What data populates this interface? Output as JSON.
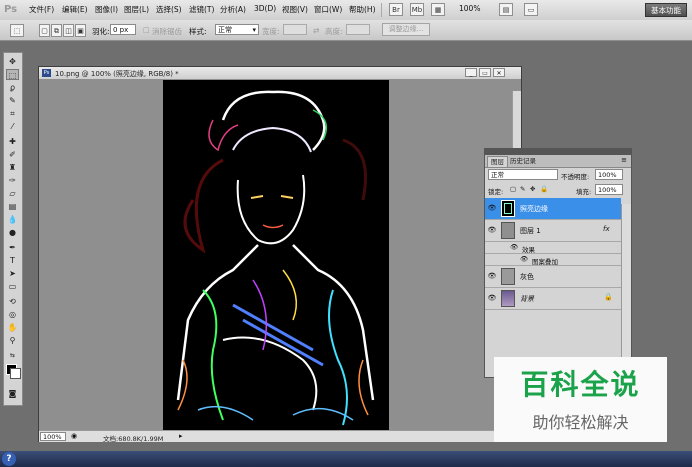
{
  "app": {
    "logo": "Ps"
  },
  "menu": {
    "items": [
      "文件(F)",
      "编辑(E)",
      "图像(I)",
      "图层(L)",
      "选择(S)",
      "滤镜(T)",
      "分析(A)",
      "3D(D)",
      "视图(V)",
      "窗口(W)",
      "帮助(H)"
    ],
    "zoom": "100%",
    "workspace": "基本功能"
  },
  "options": {
    "feather_label": "羽化:",
    "feather_value": "0 px",
    "antialias_label": "消除锯齿",
    "style_label": "样式:",
    "style_value": "正常",
    "width_label": "宽度:",
    "height_label": "高度:",
    "refine_label": "调整边缘..."
  },
  "document": {
    "title": "10.png @ 100% (照亮边缘, RGB/8) *",
    "zoom": "100%",
    "doc_size": "文档:680.8K/1.99M"
  },
  "layers_panel": {
    "tabs": [
      "图层",
      "历史记录"
    ],
    "blend_mode": "正常",
    "opacity_label": "不透明度:",
    "opacity": "100%",
    "lock_label": "锁定:",
    "fill_label": "填充:",
    "fill": "100%",
    "layers": [
      {
        "name": "照亮边缘",
        "selected": true,
        "thumb": "art"
      },
      {
        "name": "图层 1",
        "selected": false,
        "thumb": "gray",
        "has_fx": true
      },
      {
        "name": "灰色",
        "selected": false,
        "thumb": "gray"
      },
      {
        "name": "背景",
        "selected": false,
        "thumb": "photo",
        "locked": true
      }
    ],
    "effects_label": "效果",
    "effect_item": "图案叠加",
    "fx_symbol": "fx"
  },
  "watermark": {
    "title": "百科全说",
    "subtitle": "助你轻松解决"
  },
  "taskbar": {
    "help": "?"
  }
}
